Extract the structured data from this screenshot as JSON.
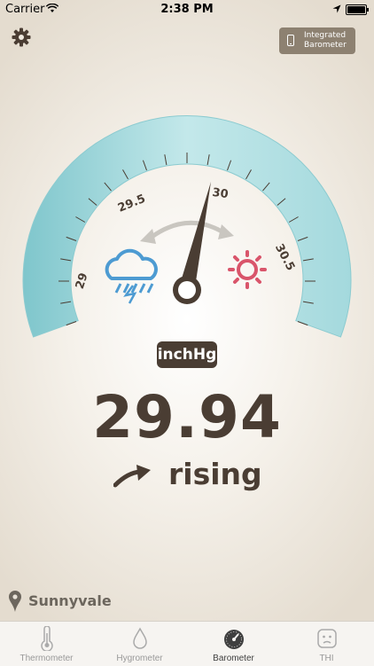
{
  "status_bar": {
    "carrier": "Carrier",
    "time": "2:38 PM"
  },
  "header": {
    "integrated_line1": "Integrated",
    "integrated_line2": "Barometer"
  },
  "gauge": {
    "tick_labels": [
      "29",
      "29.5",
      "30",
      "30.5"
    ],
    "value": 29.94,
    "colors": {
      "arc": "#a9dde0",
      "arc_dark": "#8ecfd4",
      "needle": "#4a3d33",
      "rain": "#4d9bd2",
      "sun": "#d9556b"
    }
  },
  "unit": "inchHg",
  "reading": "29.94",
  "trend": "rising",
  "location": "Sunnyvale",
  "tabs": [
    {
      "label": "Thermometer",
      "icon": "thermometer-icon"
    },
    {
      "label": "Hygrometer",
      "icon": "drop-icon"
    },
    {
      "label": "Barometer",
      "icon": "gauge-icon"
    },
    {
      "label": "THI",
      "icon": "frown-face-icon"
    }
  ],
  "active_tab": "Barometer"
}
